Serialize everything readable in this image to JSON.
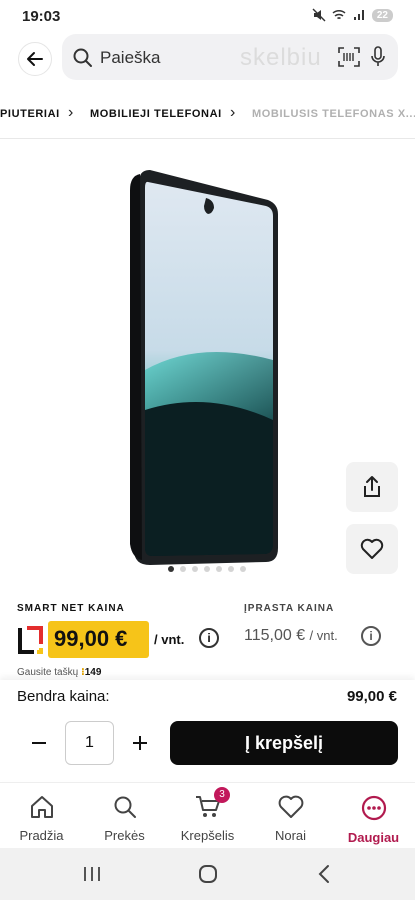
{
  "status": {
    "time": "19:03",
    "battery": "22"
  },
  "search": {
    "placeholder": "Paieška",
    "watermark": "skelbiu"
  },
  "breadcrumbs": [
    "PIUTERIAI",
    "MOBILIEJI TELEFONAI",
    "MOBILUSIS TELEFONAS X..."
  ],
  "gallery": {
    "dots_total": 7,
    "active_dot": 0
  },
  "price": {
    "smart_label": "SMART NET KAINA",
    "smart_price": "99,00 €",
    "unit": "/ vnt.",
    "regular_label": "ĮPRASTA KAINA",
    "regular_price": "115,00 €",
    "regular_unit": "/ vnt.",
    "points_label": "Gausite taškų",
    "points_value": "149"
  },
  "purchase": {
    "total_label": "Bendra kaina:",
    "total_value": "99,00 €",
    "quantity": "1",
    "cart_button": "Į krepšelį"
  },
  "nav": {
    "items": [
      {
        "label": "Pradžia",
        "icon": "home-icon"
      },
      {
        "label": "Prekės",
        "icon": "search-icon"
      },
      {
        "label": "Krepšelis",
        "icon": "cart-icon",
        "badge": "3"
      },
      {
        "label": "Norai",
        "icon": "heart-icon"
      },
      {
        "label": "Daugiau",
        "icon": "more-icon"
      }
    ]
  },
  "colors": {
    "accent": "#b11a4e",
    "price_tag": "#f6c419",
    "cart_button": "#0c0c0c"
  }
}
